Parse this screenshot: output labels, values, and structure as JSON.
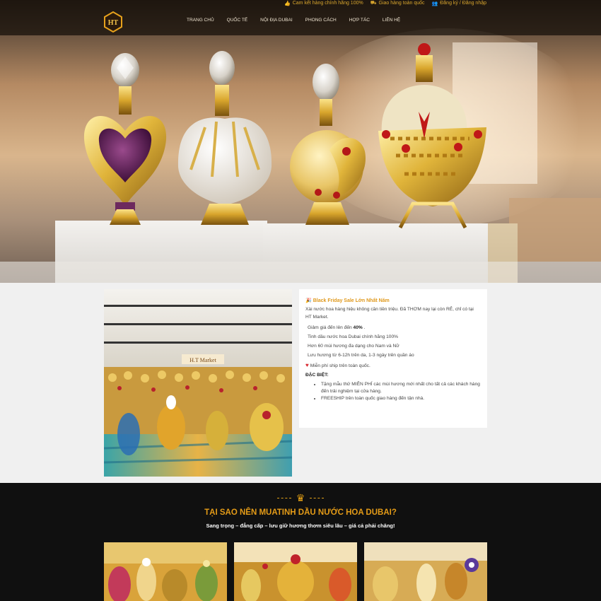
{
  "topbar": {
    "links": [
      {
        "icon": "thumbs-up-icon",
        "label": "Cam kết hàng chính hãng 100%"
      },
      {
        "icon": "truck-icon",
        "label": "Giao hàng toàn quốc"
      },
      {
        "icon": "user-plus-icon",
        "label": "Đăng ký / Đăng nhập"
      }
    ]
  },
  "logo": {
    "text": "HT"
  },
  "nav": {
    "items": [
      "Trang chủ",
      "Quốc tế",
      "Nội địa Dubai",
      "Phong cách",
      "Hợp tác",
      "Liên hệ"
    ]
  },
  "promo": {
    "title": "Black Friday Sale Lớn Nhất Năm",
    "intro": "Xài nước hoa hàng hiệu không cần tiền triệu. Đã THƠM nay lại còn RẺ, chỉ có tại HT Market.",
    "discount_prefix": "Giảm giá đến  lên đến",
    "discount_value": "40%",
    "discount_suffix": ".",
    "lines": [
      "Tinh dầu nước hoa Dubai chính hãng 100%",
      "Hơn 60 mùi hương đa dạng cho Nam và Nữ",
      "Lưu hương từ 6-12h trên da, 1-3 ngày trên quần áo"
    ],
    "freeship": "Miễn phí ship trên toàn quốc.",
    "special_label": "ĐẶC BIỆT:",
    "bullets": [
      "Tặng mẫu thử MIỄN PHÍ các mùi hương mới nhất cho tất cả các khách hàng đến trải nghiệm tại cửa hàng.",
      "FREESHIP trên toàn quốc giao hàng đến tận nhà."
    ]
  },
  "intro_image": {
    "sign_text": "H.T Market"
  },
  "why": {
    "title": "TẠI SAO NÊN MUATINH DẦU NƯỚC HOA DUBAI?",
    "subtitle": "Sang trọng – đẳng cấp – lưu giữ hương thơm siêu lâu – giá cả phải chăng!"
  },
  "colors": {
    "accent": "#e49b17",
    "topbar_text": "#d9a62e",
    "dark_section": "#101010",
    "heart": "#d8272e"
  }
}
